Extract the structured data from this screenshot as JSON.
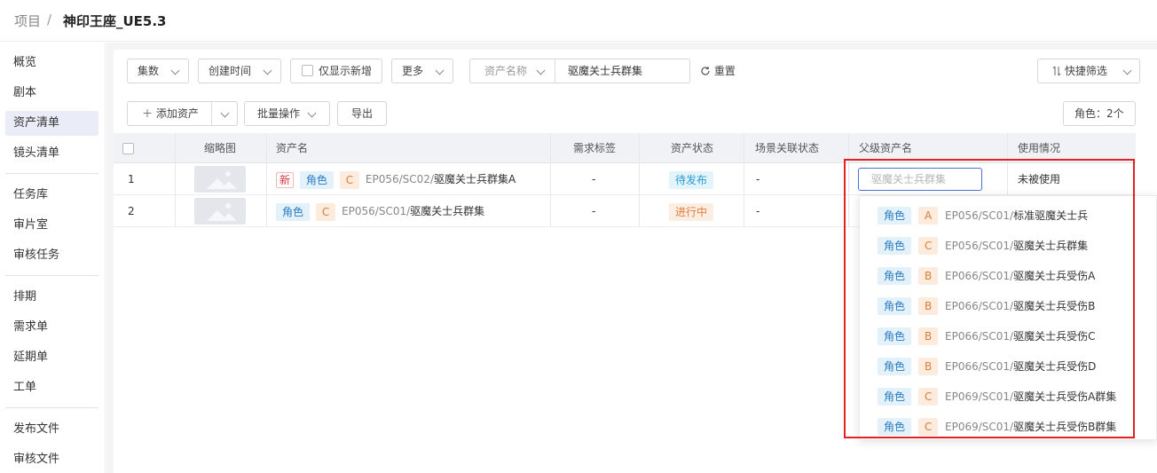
{
  "breadcrumb": {
    "root": "项目",
    "separator": "/",
    "current": "神印王座_UE5.3"
  },
  "sidebar": {
    "groups": [
      [
        {
          "label": "概览"
        },
        {
          "label": "剧本"
        },
        {
          "label": "资产清单",
          "active": true
        },
        {
          "label": "镜头清单"
        }
      ],
      [
        {
          "label": "任务库"
        },
        {
          "label": "审片室"
        },
        {
          "label": "审核任务"
        }
      ],
      [
        {
          "label": "排期"
        },
        {
          "label": "需求单"
        },
        {
          "label": "延期单"
        },
        {
          "label": "工单"
        }
      ],
      [
        {
          "label": "发布文件"
        },
        {
          "label": "审核文件"
        }
      ]
    ]
  },
  "filters": {
    "episode": "集数",
    "created_time": "创建时间",
    "only_new": "仅显示新增",
    "more": "更多",
    "asset_name_field": "资产名称",
    "asset_name_value": "驱魔关士兵群集",
    "reset": "重置",
    "quick_filter": "快捷筛选"
  },
  "toolbar": {
    "add_asset": "添加资产",
    "batch_ops": "批量操作",
    "export": "导出",
    "role_count": "角色：2个"
  },
  "table": {
    "columns": [
      "缩略图",
      "资产名",
      "需求标签",
      "资产状态",
      "场景关联状态",
      "父级资产名",
      "使用情况"
    ],
    "rows": [
      {
        "index": "1",
        "new_tag": "新",
        "role": "角色",
        "grade": "C",
        "code": "EP056/SC02/",
        "name": "驱魔关士兵群集A",
        "demand": "-",
        "status": "待发布",
        "scene": "-",
        "parent_placeholder": "驱魔关士兵群集",
        "usage": "未被使用"
      },
      {
        "index": "2",
        "role": "角色",
        "grade": "C",
        "code": "EP056/SC01/",
        "name": "驱魔关士兵群集",
        "demand": "-",
        "status": "进行中",
        "scene": "-"
      }
    ]
  },
  "dropdown": {
    "options": [
      {
        "role": "角色",
        "grade": "A",
        "code": "EP056/SC01/",
        "name": "标准驱魔关士兵"
      },
      {
        "role": "角色",
        "grade": "C",
        "code": "EP056/SC01/",
        "name": "驱魔关士兵群集"
      },
      {
        "role": "角色",
        "grade": "B",
        "code": "EP066/SC01/",
        "name": "驱魔关士兵受伤A"
      },
      {
        "role": "角色",
        "grade": "B",
        "code": "EP066/SC01/",
        "name": "驱魔关士兵受伤B"
      },
      {
        "role": "角色",
        "grade": "B",
        "code": "EP066/SC01/",
        "name": "驱魔关士兵受伤C"
      },
      {
        "role": "角色",
        "grade": "B",
        "code": "EP066/SC01/",
        "name": "驱魔关士兵受伤D"
      },
      {
        "role": "角色",
        "grade": "C",
        "code": "EP069/SC01/",
        "name": "驱魔关士兵受伤A群集"
      },
      {
        "role": "角色",
        "grade": "C",
        "code": "EP069/SC01/",
        "name": "驱魔关士兵受伤B群集"
      }
    ]
  },
  "colors": {
    "accent": "#4d6fd9",
    "highlight_border": "#e12222",
    "role_tag": "#2a7bbf",
    "grade_tag": "#d4803a",
    "status_pending": "#2a9bd0",
    "status_in_progress": "#e07b3a"
  }
}
